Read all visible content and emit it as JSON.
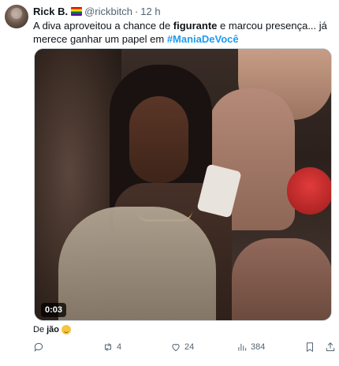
{
  "tweet": {
    "author_name": "Rick B.",
    "author_handle": "@rickbitch",
    "separator": "·",
    "time": "12 h",
    "text_part1": "A diva aproveitou a chance de ",
    "text_bold": "figurante",
    "text_part2": " e marcou presença... já merece ganhar um papel em ",
    "hashtag": "#ManiaDeVocê",
    "video_duration": "0:03",
    "reply_prefix": "De",
    "reply_bold": "jão",
    "stats": {
      "replies": "",
      "retweets": "4",
      "likes": "24",
      "views": "384"
    }
  },
  "icons": {
    "reply": "reply-icon",
    "retweet": "retweet-icon",
    "like": "heart-icon",
    "views": "views-bar-chart-icon",
    "bookmark": "bookmark-icon",
    "share": "share-icon",
    "flag": "rainbow-flag-emoji",
    "emoji": "smiling-face-emoji"
  },
  "colors": {
    "link": "#1d9bf0",
    "muted": "#536471",
    "text": "#0f1419"
  }
}
